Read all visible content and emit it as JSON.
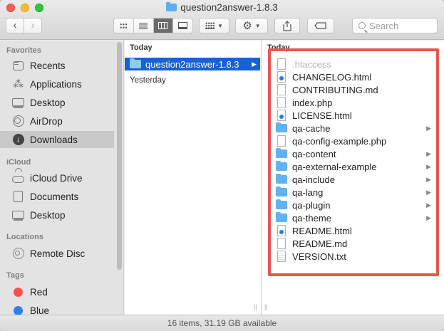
{
  "window": {
    "title": "question2answer-1.8.3"
  },
  "toolbar": {
    "back": "‹",
    "forward": "›",
    "search_placeholder": "Search",
    "icons": [
      "icon-view-icon",
      "list-view-icon",
      "column-view-icon",
      "gallery-view-icon",
      "group-icon",
      "gear-icon",
      "share-icon",
      "tag-icon"
    ]
  },
  "sidebar": {
    "sections": [
      {
        "title": "Favorites",
        "items": [
          {
            "label": "Recents",
            "icon": "recents-icon"
          },
          {
            "label": "Applications",
            "icon": "applications-icon"
          },
          {
            "label": "Desktop",
            "icon": "desktop-icon"
          },
          {
            "label": "AirDrop",
            "icon": "airdrop-icon"
          },
          {
            "label": "Downloads",
            "icon": "downloads-icon",
            "selected": true
          }
        ]
      },
      {
        "title": "iCloud",
        "items": [
          {
            "label": "iCloud Drive",
            "icon": "cloud-icon"
          },
          {
            "label": "Documents",
            "icon": "documents-icon"
          },
          {
            "label": "Desktop",
            "icon": "desktop-icon"
          }
        ]
      },
      {
        "title": "Locations",
        "items": [
          {
            "label": "Remote Disc",
            "icon": "disc-icon"
          }
        ]
      },
      {
        "title": "Tags",
        "items": [
          {
            "label": "Red",
            "color": "#f4514b"
          },
          {
            "label": "Blue",
            "color": "#2f7fee"
          }
        ]
      }
    ]
  },
  "column1": {
    "header": "Today",
    "items": [
      {
        "label": "question2answer-1.8.3",
        "kind": "folder",
        "selected": true
      }
    ],
    "section2": "Yesterday"
  },
  "column2": {
    "header": "Today",
    "items": [
      {
        "label": ".htaccess",
        "kind": "doc",
        "dim": true
      },
      {
        "label": "CHANGELOG.html",
        "kind": "html"
      },
      {
        "label": "CONTRIBUTING.md",
        "kind": "doc"
      },
      {
        "label": "index.php",
        "kind": "doc"
      },
      {
        "label": "LICENSE.html",
        "kind": "html"
      },
      {
        "label": "qa-cache",
        "kind": "folder"
      },
      {
        "label": "qa-config-example.php",
        "kind": "doc"
      },
      {
        "label": "qa-content",
        "kind": "folder"
      },
      {
        "label": "qa-external-example",
        "kind": "folder"
      },
      {
        "label": "qa-include",
        "kind": "folder"
      },
      {
        "label": "qa-lang",
        "kind": "folder"
      },
      {
        "label": "qa-plugin",
        "kind": "folder"
      },
      {
        "label": "qa-theme",
        "kind": "folder"
      },
      {
        "label": "README.html",
        "kind": "html"
      },
      {
        "label": "README.md",
        "kind": "doc"
      },
      {
        "label": "VERSION.txt",
        "kind": "txt"
      }
    ]
  },
  "status": {
    "text": "16 items, 31.19 GB available"
  },
  "highlight_color": "#e8574c"
}
